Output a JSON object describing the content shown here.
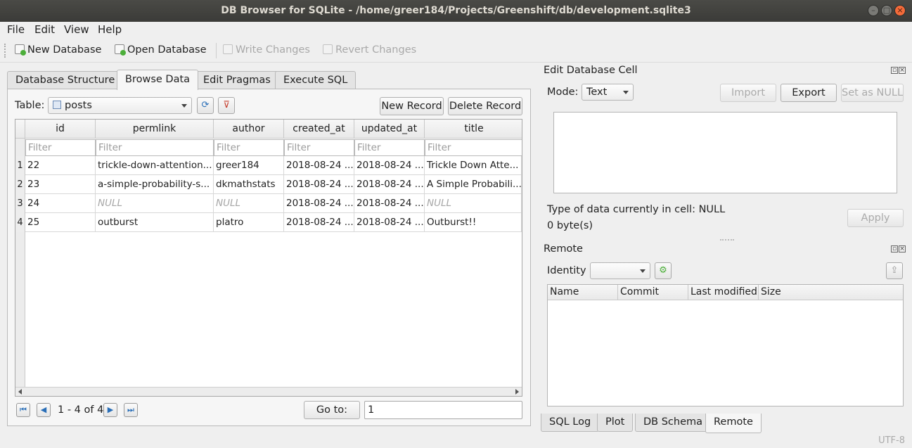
{
  "window": {
    "title": "DB Browser for SQLite - /home/greer184/Projects/Greenshift/db/development.sqlite3"
  },
  "menu": [
    "File",
    "Edit",
    "View",
    "Help"
  ],
  "toolbar": {
    "new_database": "New Database",
    "open_database": "Open Database",
    "write_changes": "Write Changes",
    "revert_changes": "Revert Changes"
  },
  "tabs": [
    "Database Structure",
    "Browse Data",
    "Edit Pragmas",
    "Execute SQL"
  ],
  "browse": {
    "table_label": "Table:",
    "table_value": "posts",
    "new_record": "New Record",
    "delete_record": "Delete Record",
    "columns": [
      "id",
      "permlink",
      "author",
      "created_at",
      "updated_at",
      "title"
    ],
    "filter_placeholder": "Filter",
    "rows": [
      {
        "num": "1",
        "cells": [
          "22",
          "trickle-down-attention...",
          "greer184",
          "2018-08-24 ...",
          "2018-08-24 ...",
          "Trickle Down Atte..."
        ]
      },
      {
        "num": "2",
        "cells": [
          "23",
          "a-simple-probability-s...",
          "dkmathstats",
          "2018-08-24 ...",
          "2018-08-24 ...",
          "A Simple Probabili..."
        ]
      },
      {
        "num": "3",
        "cells": [
          "24",
          "NULL",
          "NULL",
          "2018-08-24 ...",
          "2018-08-24 ...",
          "NULL"
        ]
      },
      {
        "num": "4",
        "cells": [
          "25",
          "outburst",
          "platro",
          "2018-08-24 ...",
          "2018-08-24 ...",
          "Outburst!!"
        ]
      }
    ],
    "record_range": "1 - 4 of 4",
    "goto_label": "Go to:",
    "goto_value": "1"
  },
  "edit_cell": {
    "title": "Edit Database Cell",
    "mode_label": "Mode:",
    "mode_value": "Text",
    "import": "Import",
    "export": "Export",
    "set_null": "Set as NULL",
    "type_info": "Type of data currently in cell: NULL",
    "size_info": "0 byte(s)",
    "apply": "Apply"
  },
  "remote": {
    "title": "Remote",
    "identity_label": "Identity",
    "columns": [
      "Name",
      "Commit",
      "Last modified",
      "Size"
    ]
  },
  "bottom_tabs": [
    "SQL Log",
    "Plot",
    "DB Schema",
    "Remote"
  ],
  "status": {
    "encoding": "UTF-8"
  }
}
